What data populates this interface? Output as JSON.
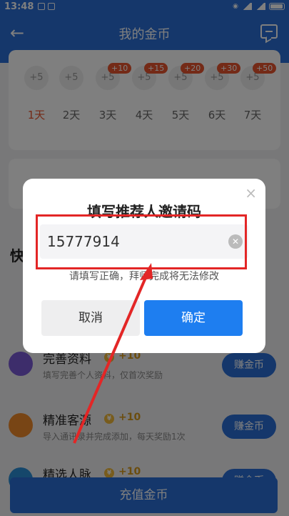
{
  "statusbar": {
    "time": "13:48",
    "net_speed": "0.00\nKB/S"
  },
  "header": {
    "title": "我的金币"
  },
  "checkin": {
    "days": [
      {
        "coin": "+5",
        "label": "1天",
        "bonus": ""
      },
      {
        "coin": "+5",
        "label": "2天",
        "bonus": ""
      },
      {
        "coin": "+5",
        "label": "3天",
        "bonus": "+10"
      },
      {
        "coin": "+5",
        "label": "4天",
        "bonus": "+15"
      },
      {
        "coin": "+5",
        "label": "5天",
        "bonus": "+20"
      },
      {
        "coin": "+5",
        "label": "6天",
        "bonus": "+30"
      },
      {
        "coin": "+5",
        "label": "7天",
        "bonus": "+50"
      }
    ]
  },
  "tasks": [
    {
      "name": "完善资料",
      "reward": "+10",
      "desc": "填写完善个人资料，仅首次奖励",
      "button": "赚金币",
      "color": "#7b5bd6"
    },
    {
      "name": "精准客源",
      "reward": "+10",
      "desc": "导入通讯录并完成添加，每天奖励1次",
      "button": "赚金币",
      "color": "#f08a2a"
    },
    {
      "name": "精选人脉",
      "reward": "+10",
      "desc": "",
      "button": "赚金币",
      "color": "#2a8ed6"
    }
  ],
  "recharge_label": "充值金币",
  "dialog": {
    "title": "填写推荐人邀请码",
    "code_value": "15777914",
    "hint": "请填写正确，拜师完成将无法修改",
    "cancel": "取消",
    "confirm": "确定",
    "close": "×"
  }
}
